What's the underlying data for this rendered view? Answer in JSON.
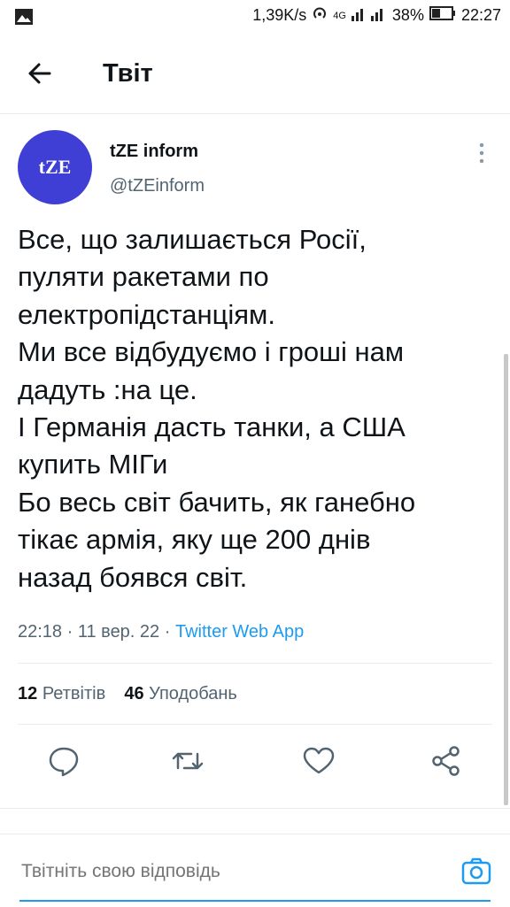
{
  "status_bar": {
    "network_speed": "1,39K/s",
    "network_type": "4G",
    "battery": "38%",
    "time": "22:27"
  },
  "header": {
    "title": "Твіт"
  },
  "tweet": {
    "author_name": "tZE inform",
    "author_handle": "@tZEinform",
    "avatar_text": "tZE",
    "text": "Все, що залишається Росії,\nпуляти ракетами по\nелектропідстанціям.\nМи все відбудуємо і гроші нам\nдадуть :на це.\nІ Германія дасть танки, а США\nкупить МІГи\nБо  весь світ бачить, як ганебно\nтікає армія, яку ще 200 днів\nназад боявся світ.",
    "time": "22:18",
    "date": "11 вер. 22",
    "source": "Twitter Web App",
    "retweets_count": "12",
    "retweets_label": "Ретвітів",
    "likes_count": "46",
    "likes_label": "Уподобань"
  },
  "reply": {
    "placeholder": "Твітніть свою відповідь"
  },
  "colors": {
    "accent": "#1d9bf0",
    "avatar_bg": "#3f3fd6",
    "secondary_text": "#536471"
  }
}
